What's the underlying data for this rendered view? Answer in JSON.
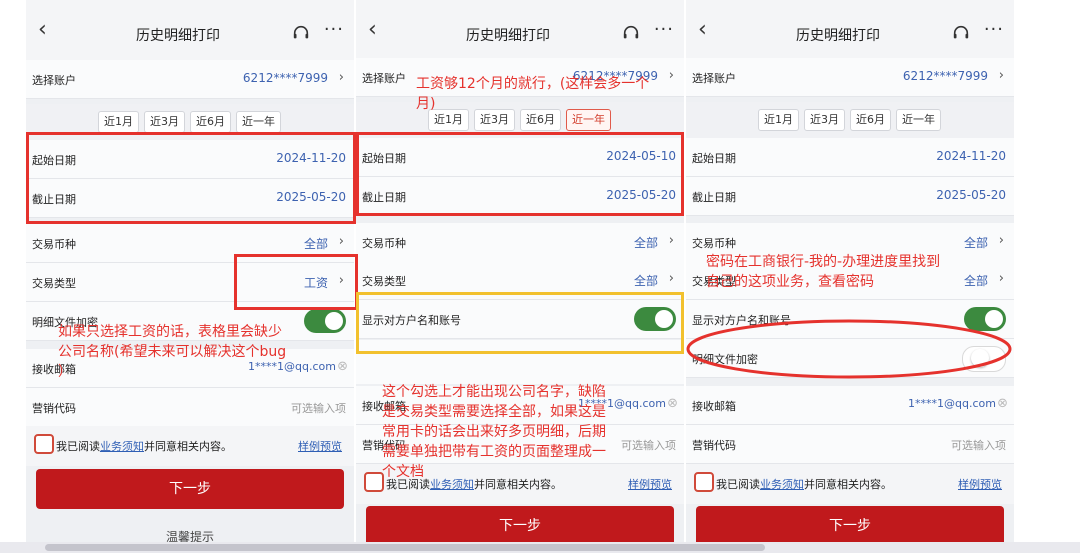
{
  "screens": [
    {
      "nav_title": "历史明细打印",
      "account": {
        "label": "选择账户",
        "value": "6212****7999"
      },
      "quick": [
        "近1月",
        "近3月",
        "近6月",
        "近一年"
      ],
      "start": {
        "label": "起始日期",
        "value": "2024-11-20"
      },
      "end": {
        "label": "截止日期",
        "value": "2025-05-20"
      },
      "currency": {
        "label": "交易币种",
        "value": "全部"
      },
      "txn_type": {
        "label": "交易类型",
        "value": "工资"
      },
      "encrypt": {
        "label": "明细文件加密"
      },
      "email": {
        "label": "接收邮箱",
        "value": "1****1@qq.com"
      },
      "marketing": {
        "label": "营销代码",
        "placeholder": "可选输入项"
      },
      "agree": {
        "prefix": "我已阅读",
        "link": "业务须知",
        "suffix": "并同意相关内容。",
        "sample": "样例预览"
      },
      "next": "下一步",
      "bottom_text": "温馨提示"
    },
    {
      "nav_title": "历史明细打印",
      "account": {
        "label": "选择账户",
        "value": "6212****7999"
      },
      "quick": [
        "近1月",
        "近3月",
        "近6月",
        "近一年"
      ],
      "start": {
        "label": "起始日期",
        "value": "2024-05-10"
      },
      "end": {
        "label": "截止日期",
        "value": "2025-05-20"
      },
      "currency": {
        "label": "交易币种",
        "value": "全部"
      },
      "txn_type": {
        "label": "交易类型",
        "value": "全部"
      },
      "show_name": {
        "label": "显示对方户名和账号"
      },
      "email": {
        "label": "接收邮箱",
        "value": "1****1@qq.com"
      },
      "marketing": {
        "label": "营销代码",
        "placeholder": "可选输入项"
      },
      "agree": {
        "prefix": "我已阅读",
        "link": "业务须知",
        "suffix": "并同意相关内容。",
        "sample": "样例预览"
      },
      "next": "下一步"
    },
    {
      "nav_title": "历史明细打印",
      "account": {
        "label": "选择账户",
        "value": "6212****7999"
      },
      "quick": [
        "近1月",
        "近3月",
        "近6月",
        "近一年"
      ],
      "start": {
        "label": "起始日期",
        "value": "2024-11-20"
      },
      "end": {
        "label": "截止日期",
        "value": "2025-05-20"
      },
      "currency": {
        "label": "交易币种",
        "value": "全部"
      },
      "txn_type": {
        "label": "交易类型",
        "value": "全部"
      },
      "show_name": {
        "label": "显示对方户名和账号"
      },
      "encrypt": {
        "label": "明细文件加密"
      },
      "email": {
        "label": "接收邮箱",
        "value": "1****1@qq.com"
      },
      "marketing": {
        "label": "营销代码",
        "placeholder": "可选输入项"
      },
      "agree": {
        "prefix": "我已阅读",
        "link": "业务须知",
        "suffix": "并同意相关内容。",
        "sample": "样例预览"
      },
      "next": "下一步"
    }
  ],
  "annotations": {
    "note1_line1": "如果只选择工资的话，表格里会缺少",
    "note1_line2": "公司名称(希望未来可以解决这个bug",
    "note1_line3": "）",
    "note2_line1": "工资够12个月的就行，(这样会多一个",
    "note2_line2": "月)",
    "note3_line1": "这个勾选上才能出现公司名字，缺陷",
    "note3_line2": "是交易类型需要选择全部，如果这是",
    "note3_line3": "常用卡的话会出来好多页明细，后期",
    "note3_line4": "需要单独把带有工资的页面整理成一",
    "note3_line5": "个文档",
    "note4_line1": "密码在工商银行-我的-办理进度里找到",
    "note4_line2": "自己的这项业务，查看密码"
  },
  "colors": {
    "accent_red": "#c0191c",
    "annotation_red": "#e5322d",
    "annotation_yellow": "#f2c12e",
    "value_blue": "#3d62b0",
    "toggle_green": "#3c8a3f"
  },
  "icons": [
    "back-arrow-icon",
    "headset-icon",
    "more-dots-icon",
    "chevron-right-icon",
    "checkbox-icon"
  ]
}
